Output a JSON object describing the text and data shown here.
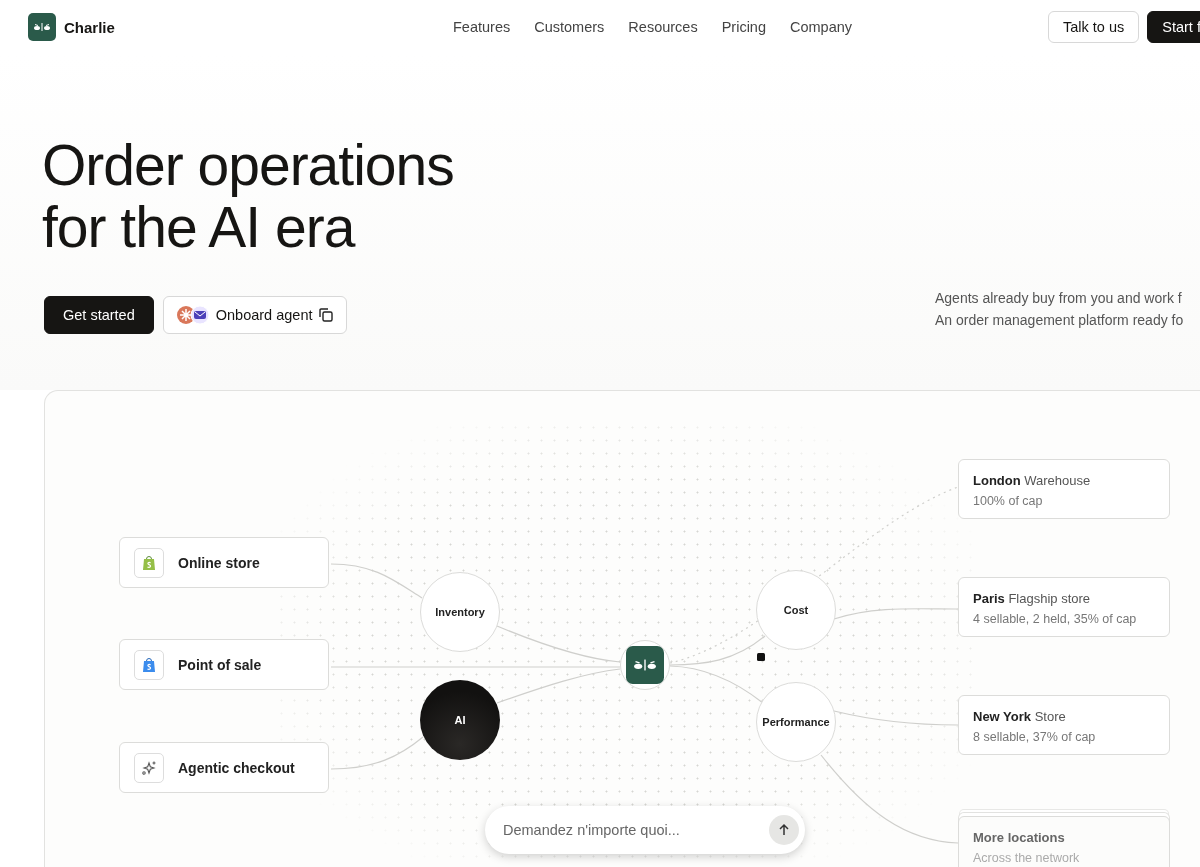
{
  "brand": {
    "name": "Charlie"
  },
  "nav": [
    "Features",
    "Customers",
    "Resources",
    "Pricing",
    "Company"
  ],
  "header_actions": [
    {
      "label": "Talk to us",
      "kind": "secondary"
    },
    {
      "label": "Start f",
      "kind": "primary"
    }
  ],
  "hero": {
    "title_lines": [
      "Order operations",
      "for the AI era"
    ],
    "primary_action": "Get started",
    "agent_button": "Onboard agent",
    "tagline_lines": [
      "Agents already buy from you and work f",
      "An order management platform ready fo"
    ]
  },
  "diagram": {
    "sources": [
      {
        "label": "Online store",
        "kind": "online"
      },
      {
        "label": "Point of sale",
        "kind": "pos"
      },
      {
        "label": "Agentic checkout",
        "kind": "agentic"
      }
    ],
    "hubs": [
      {
        "label": "Inventory",
        "kind": "light"
      },
      {
        "label": "AI",
        "kind": "dark"
      },
      {
        "label": "Cost",
        "kind": "light"
      },
      {
        "label": "Performance",
        "kind": "light"
      }
    ],
    "locations": [
      {
        "city": "London",
        "type": "Warehouse",
        "detail": "100% of cap",
        "kind": "single"
      },
      {
        "city": "Paris",
        "type": "Flagship store",
        "detail": "4 sellable, 2 held, 35% of cap",
        "kind": "single"
      },
      {
        "city": "New York",
        "type": "Store",
        "detail": "8 sellable, 37% of cap",
        "kind": "single"
      },
      {
        "city": "More locations",
        "detail": "Across the network",
        "kind": "stack"
      }
    ],
    "chat": {
      "placeholder": "Demandez n'importe quoi..."
    }
  }
}
